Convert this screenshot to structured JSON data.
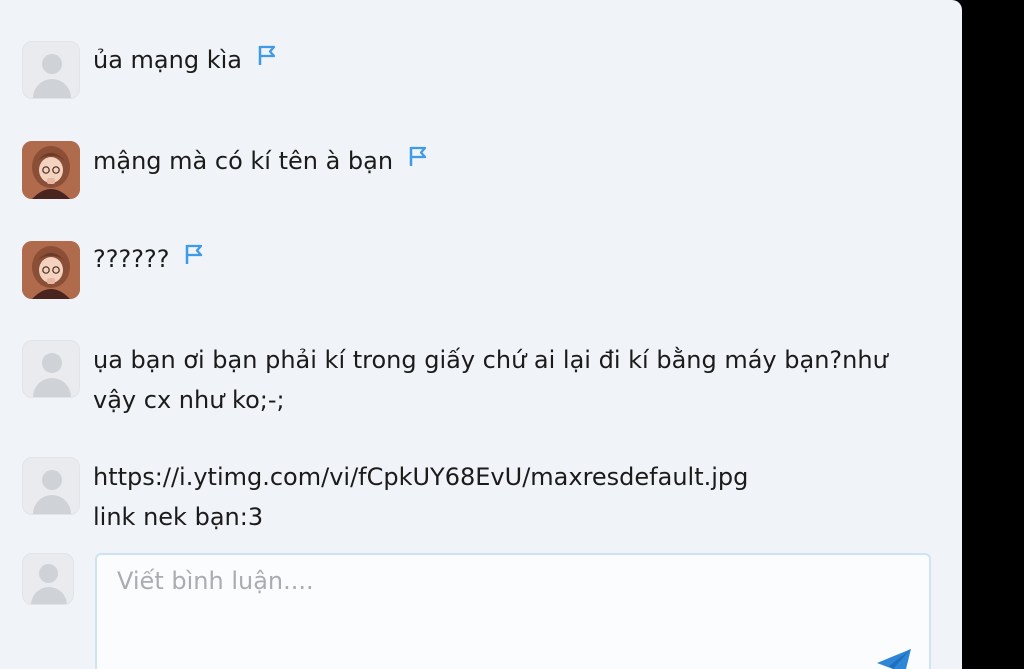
{
  "comments": [
    {
      "text": "ủa mạng kìa",
      "avatar": "default-avatar",
      "flag": true
    },
    {
      "text": "mậng mà có kí tên à bạn",
      "avatar": "girl-avatar",
      "flag": true
    },
    {
      "text": "??????",
      "avatar": "girl-avatar",
      "flag": true
    },
    {
      "text": "ụa bạn ơi bạn phải kí trong giấy chứ ai lại đi kí bằng máy bạn?như\nvậy cx như ko;-;",
      "avatar": "default-avatar",
      "flag": false
    },
    {
      "text": "https://i.ytimg.com/vi/fCpkUY68EvU/maxresdefault.jpg\nlink nek bạn:3",
      "avatar": "default-avatar",
      "flag": false
    }
  ],
  "input": {
    "placeholder": "Viết bình luận....",
    "send_icon": "paper-plane-icon"
  },
  "colors": {
    "panel_bg": "#f0f3f7",
    "flag": "#3d9be9",
    "send": "#2f86d6"
  }
}
